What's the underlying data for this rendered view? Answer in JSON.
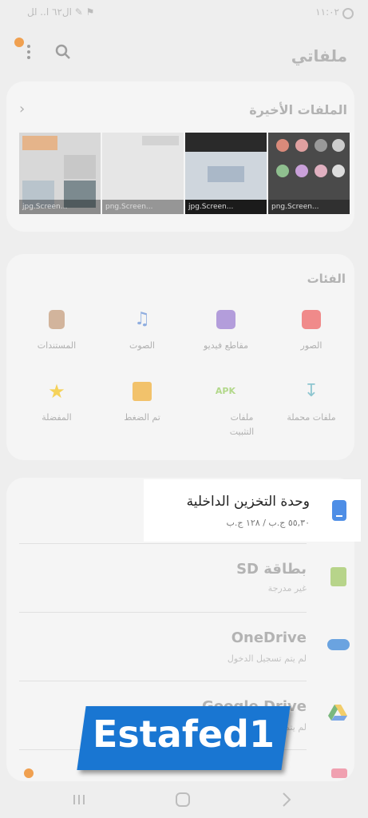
{
  "status_bar": {
    "left_text": "ال٦٢ ا.. ا‍ل ✎ ⚑",
    "time": "١١:٠٢"
  },
  "header": {
    "title": "ملفاتي"
  },
  "recent": {
    "title": "الملفات الأخيرة",
    "items": [
      {
        "caption": "jpg.Screen..."
      },
      {
        "caption": "png.Screen..."
      },
      {
        "caption": "jpg.Screen..."
      },
      {
        "caption": "png.Screen..."
      }
    ]
  },
  "categories": {
    "title": "الفئات",
    "items": [
      {
        "label": "الصور",
        "icon": "image-icon",
        "color": "#f08a8a"
      },
      {
        "label": "مقاطع فيديو",
        "icon": "video-icon",
        "color": "#b39ddb"
      },
      {
        "label": "الصوت",
        "icon": "music-icon",
        "color": "#90aee0"
      },
      {
        "label": "المستندات",
        "icon": "document-icon",
        "color": "#d2b49c"
      },
      {
        "label": "ملفات محملة",
        "icon": "download-icon",
        "color": "#8ec6d0"
      },
      {
        "label": "ملفات التثبيت",
        "icon": "apk-icon",
        "color": "#b2d88a",
        "icon_text": "APK"
      },
      {
        "label": "تم الضغط",
        "icon": "zip-folder-icon",
        "color": "#f2c26b"
      },
      {
        "label": "المفضلة",
        "icon": "star-icon",
        "color": "#f5d25a"
      }
    ]
  },
  "storage": {
    "internal": {
      "title": "وحدة التخزين الداخلية",
      "usage": "٥٥,٣٠ ج.ب / ١٢٨ ج.ب",
      "icon": "phone-storage-icon",
      "color": "#4e8ee6"
    },
    "sd": {
      "title": "بطاقة SD",
      "sub": "غير مدرجة",
      "icon": "sd-card-icon",
      "color": "#b7d48a"
    },
    "onedrive": {
      "title": "OneDrive",
      "sub": "لم يتم تسجيل الدخول",
      "icon": "onedrive-icon",
      "color": "#6aa3e0"
    },
    "gdrive": {
      "title": "Google Drive",
      "sub": "لم يتم تسجيل الدخول",
      "icon": "google-drive-icon"
    }
  },
  "watermark": {
    "text": "Estafed1",
    "color": "#1976d2"
  },
  "accent": "#f0a050"
}
